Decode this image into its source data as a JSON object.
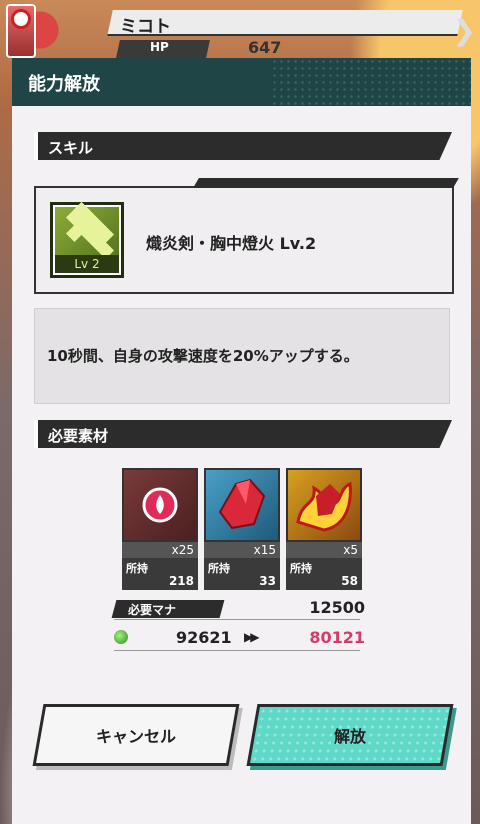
{
  "hud": {
    "name": "ミコト",
    "hp_label": "HP",
    "hp_value": "647"
  },
  "dialog": {
    "title": "能力解放"
  },
  "skill_section": {
    "header": "スキル",
    "skill": {
      "level_badge": "Lv 2",
      "name": "熾炎剣・胸中燈火 Lv.2",
      "icon": "double-chevron-up-icon"
    },
    "description": "10秒間、自身の攻撃速度を20%アップする。"
  },
  "materials_section": {
    "header": "必要素材",
    "owned_label": "所持",
    "items": [
      {
        "icon": "fire-orb-icon",
        "required": "x25",
        "owned": "218"
      },
      {
        "icon": "crystal-shard-icon",
        "required": "x15",
        "owned": "33"
      },
      {
        "icon": "flame-crystal-icon",
        "required": "x5",
        "owned": "58"
      }
    ]
  },
  "mana": {
    "label": "必要マナ",
    "cost": "12500",
    "current": "92621",
    "after": "80121",
    "after_color": "#d23b6a"
  },
  "buttons": {
    "cancel": "キャンセル",
    "release": "解放"
  }
}
